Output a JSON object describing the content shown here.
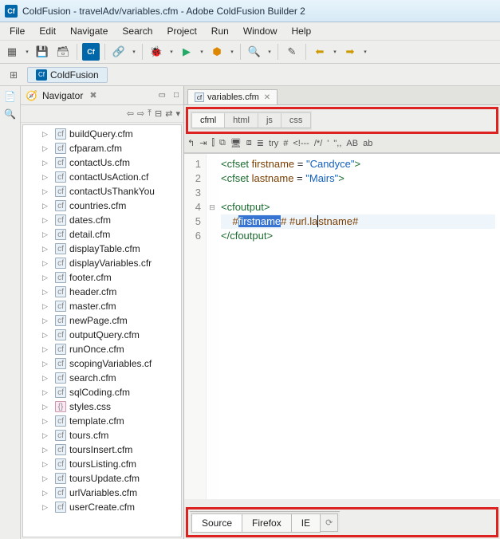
{
  "window": {
    "title": "ColdFusion - travelAdv/variables.cfm - Adobe ColdFusion Builder 2",
    "app_icon_label": "Cf"
  },
  "menu": [
    "File",
    "Edit",
    "Navigate",
    "Search",
    "Project",
    "Run",
    "Window",
    "Help"
  ],
  "perspective": {
    "label": "ColdFusion",
    "icon_label": "Cf"
  },
  "navigator": {
    "title": "Navigator",
    "files": [
      {
        "name": "buildQuery.cfm",
        "type": "cfm"
      },
      {
        "name": "cfparam.cfm",
        "type": "cfm"
      },
      {
        "name": "contactUs.cfm",
        "type": "cfm"
      },
      {
        "name": "contactUsAction.cf",
        "type": "cfm"
      },
      {
        "name": "contactUsThankYou",
        "type": "cfm"
      },
      {
        "name": "countries.cfm",
        "type": "cfm"
      },
      {
        "name": "dates.cfm",
        "type": "cfm"
      },
      {
        "name": "detail.cfm",
        "type": "cfm"
      },
      {
        "name": "displayTable.cfm",
        "type": "cfm"
      },
      {
        "name": "displayVariables.cfr",
        "type": "cfm"
      },
      {
        "name": "footer.cfm",
        "type": "cfm"
      },
      {
        "name": "header.cfm",
        "type": "cfm"
      },
      {
        "name": "master.cfm",
        "type": "cfm"
      },
      {
        "name": "newPage.cfm",
        "type": "cfm"
      },
      {
        "name": "outputQuery.cfm",
        "type": "cfm"
      },
      {
        "name": "runOnce.cfm",
        "type": "cfm"
      },
      {
        "name": "scopingVariables.cf",
        "type": "cfm"
      },
      {
        "name": "search.cfm",
        "type": "cfm"
      },
      {
        "name": "sqlCoding.cfm",
        "type": "cfm"
      },
      {
        "name": "styles.css",
        "type": "css"
      },
      {
        "name": "template.cfm",
        "type": "cfm"
      },
      {
        "name": "tours.cfm",
        "type": "cfm"
      },
      {
        "name": "toursInsert.cfm",
        "type": "cfm"
      },
      {
        "name": "toursListing.cfm",
        "type": "cfm"
      },
      {
        "name": "toursUpdate.cfm",
        "type": "cfm"
      },
      {
        "name": "urlVariables.cfm",
        "type": "cfm"
      },
      {
        "name": "userCreate.cfm",
        "type": "cfm"
      }
    ]
  },
  "editor": {
    "tab_label": "variables.cfm",
    "lang_tabs": [
      "cfml",
      "html",
      "js",
      "css"
    ],
    "active_lang": "cfml",
    "mini_toolbar": [
      "↰",
      "⇥",
      "⫿",
      "⧉",
      "🖥",
      "⧈",
      "≣",
      "try",
      "#",
      "<!---",
      "/*/",
      "'",
      "\",,",
      "AB",
      "ab"
    ],
    "lines": {
      "l1_a": "<cfset ",
      "l1_b": "firstname",
      "l1_c": " = ",
      "l1_d": "\"Candyce\"",
      "l1_e": ">",
      "l2_a": "<cfset ",
      "l2_b": "lastname",
      "l2_c": " = ",
      "l2_d": "\"Mairs\"",
      "l2_e": ">",
      "l3": "",
      "l4": "<cfoutput>",
      "l5_a": "    #",
      "l5_sel": "firstname",
      "l5_b": "# #url.la",
      "l5_c": "stname#",
      "l6": "</cfoutput>"
    },
    "line_numbers": [
      "1",
      "2",
      "3",
      "4",
      "5",
      "6"
    ],
    "bottom_tabs": [
      "Source",
      "Firefox",
      "IE"
    ],
    "active_bottom": "Source"
  }
}
